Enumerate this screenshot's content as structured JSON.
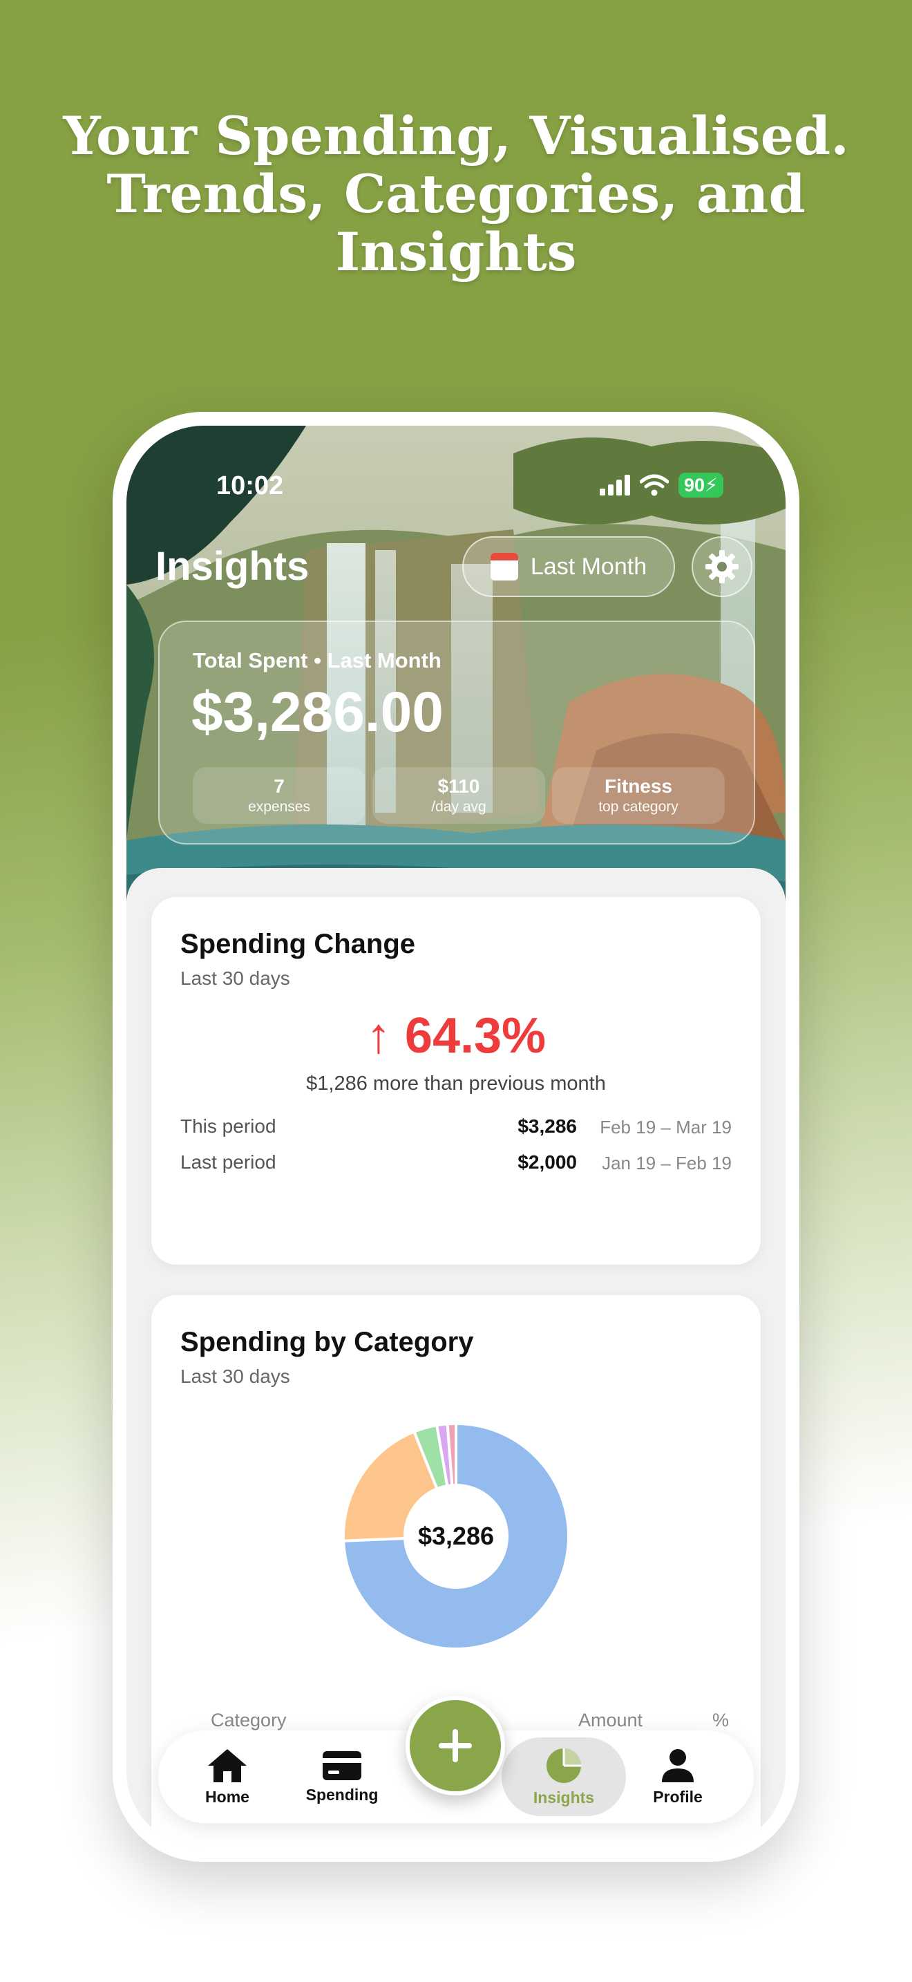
{
  "headline": {
    "line1": "Your Spending, Visualised.",
    "line2": "Trends, Categories, and",
    "line3": "Insights"
  },
  "status_bar": {
    "time": "10:02",
    "battery": "90"
  },
  "header": {
    "title": "Insights",
    "period_label": "Last Month"
  },
  "summary": {
    "label": "Total Spent • Last Month",
    "amount": "$3,286.00",
    "stats": [
      {
        "value": "7",
        "caption": "expenses"
      },
      {
        "value": "$110",
        "caption": "/day avg"
      },
      {
        "value": "Fitness",
        "caption": "top category"
      }
    ]
  },
  "spending_change": {
    "title": "Spending Change",
    "subtitle": "Last 30 days",
    "value": "↑ 64.3%",
    "description": "$1,286 more than previous month",
    "rows": [
      {
        "label": "This period",
        "amount": "$3,286",
        "range": "Feb 19 – Mar 19"
      },
      {
        "label": "Last period",
        "amount": "$2,000",
        "range": "Jan 19 – Feb 19"
      }
    ]
  },
  "spending_by_category": {
    "title": "Spending by Category",
    "subtitle": "Last 30 days",
    "total": "$3,286",
    "columns": {
      "category": "Category",
      "amount": "Amount",
      "percent": "%"
    },
    "slices": [
      {
        "value": 73.6,
        "color": "#93bbee"
      },
      {
        "value": 19.4,
        "color": "#fdc58c"
      },
      {
        "value": 3.3,
        "color": "#9ee0a5"
      },
      {
        "value": 1.5,
        "color": "#d9a6f0"
      },
      {
        "value": 1.2,
        "color": "#f4a0b4"
      }
    ]
  },
  "tabbar": {
    "tabs": [
      {
        "label": "Home",
        "icon": "home-icon"
      },
      {
        "label": "Spending",
        "icon": "card-icon"
      },
      {
        "label": "Insights",
        "icon": "pie-chart-icon",
        "active": true
      },
      {
        "label": "Profile",
        "icon": "person-icon"
      }
    ],
    "accent": "#8aa64a"
  },
  "colors": {
    "background_green": "#86a044",
    "negative": "#ee3b3b",
    "battery": "#34c759"
  }
}
